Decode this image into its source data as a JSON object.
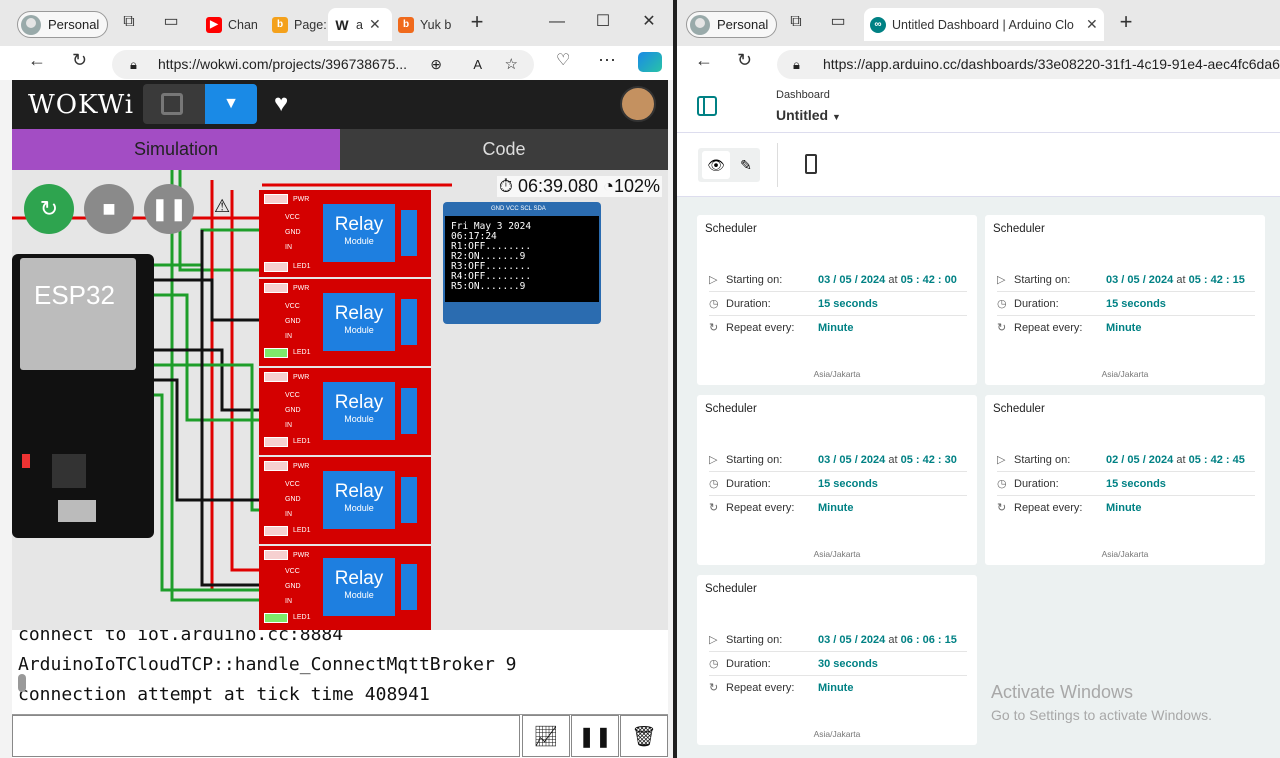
{
  "left": {
    "profile_label": "Personal",
    "tabs": [
      {
        "label": "Chan",
        "color": "#ff0000",
        "glyph": "▶"
      },
      {
        "label": "Page:",
        "color": "#f4a11b",
        "glyph": "b"
      },
      {
        "label": "a",
        "color": "#222222",
        "glyph": "W"
      },
      {
        "label": "Yuk b",
        "color": "#f06a1c",
        "glyph": "b"
      }
    ],
    "url": "https://wokwi.com/projects/396738675...",
    "wokwi": {
      "logo": "WOKWi",
      "tab_simulation": "Simulation",
      "tab_code": "Code",
      "timer": "06:39.080",
      "speed": "102%",
      "board_label": "ESP32",
      "relay_label": "Relay",
      "relay_sub": "Module",
      "pin_pwr": "PWR",
      "pin_vcc": "VCC",
      "pin_gnd": "GND",
      "pin_in": "IN",
      "pin_led": "LED1",
      "oled_pins": "GND VCC SCL SDA",
      "oled_lines": [
        "Fri May  3 2024",
        "   06:17:24",
        "R1:OFF........",
        "R2:ON.......9",
        "R3:OFF........",
        "R4:OFF........",
        "R5:ON.......9"
      ],
      "console_lines": [
        "connect to iot.arduino.cc:8884",
        "ArduinoIoTCloudTCP::handle_ConnectMqttBroker 9",
        "connection attempt at tick time 408941"
      ]
    }
  },
  "right": {
    "profile_label": "Personal",
    "tab_title": "Untitled Dashboard | Arduino Clo",
    "url": "https://app.arduino.cc/dashboards/33e08220-31f1-4c19-91e4-aec4fc6da6",
    "breadcrumb": "Dashboard",
    "dashboard_name": "Untitled",
    "cards": [
      {
        "title": "Scheduler",
        "start_label": "Starting on:",
        "start_date": "03 / 05 / 2024",
        "at": "at",
        "start_time": "05 : 42 : 00",
        "duration_label": "Duration:",
        "duration": "15 seconds",
        "repeat_label": "Repeat every:",
        "repeat": "Minute",
        "tz": "Asia/Jakarta"
      },
      {
        "title": "Scheduler",
        "start_label": "Starting on:",
        "start_date": "03 / 05 / 2024",
        "at": "at",
        "start_time": "05 : 42 : 15",
        "duration_label": "Duration:",
        "duration": "15 seconds",
        "repeat_label": "Repeat every:",
        "repeat": "Minute",
        "tz": "Asia/Jakarta"
      },
      {
        "title": "Scheduler",
        "start_label": "Starting on:",
        "start_date": "03 / 05 / 2024",
        "at": "at",
        "start_time": "05 : 42 : 30",
        "duration_label": "Duration:",
        "duration": "15 seconds",
        "repeat_label": "Repeat every:",
        "repeat": "Minute",
        "tz": "Asia/Jakarta"
      },
      {
        "title": "Scheduler",
        "start_label": "Starting on:",
        "start_date": "02 / 05 / 2024",
        "at": "at",
        "start_time": "05 : 42 : 45",
        "duration_label": "Duration:",
        "duration": "15 seconds",
        "repeat_label": "Repeat every:",
        "repeat": "Minute",
        "tz": "Asia/Jakarta"
      },
      {
        "title": "Scheduler",
        "start_label": "Starting on:",
        "start_date": "03 / 05 / 2024",
        "at": "at",
        "start_time": "06 : 06 : 15",
        "duration_label": "Duration:",
        "duration": "30 seconds",
        "repeat_label": "Repeat every:",
        "repeat": "Minute",
        "tz": "Asia/Jakarta"
      }
    ],
    "watermark_title": "Activate Windows",
    "watermark_sub": "Go to Settings to activate Windows."
  }
}
